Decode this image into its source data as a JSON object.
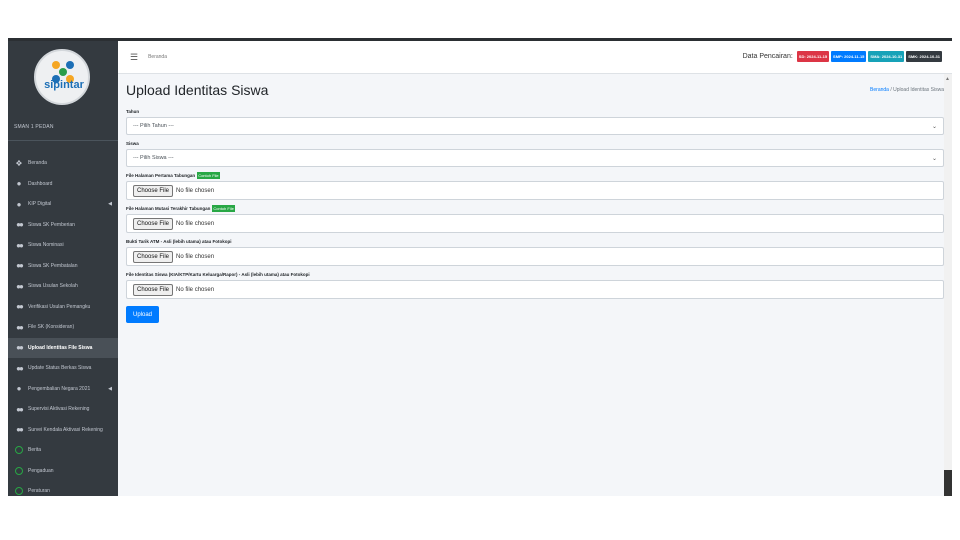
{
  "sidebar": {
    "logo_text": "sipintar",
    "school": "SMAN 1 PEDAN",
    "items": [
      {
        "label": "Beranda",
        "icon": "home-icon"
      },
      {
        "label": "Dashboard",
        "icon": "dashboard-icon"
      },
      {
        "label": "KIP Digital",
        "icon": "dashboard-icon"
      },
      {
        "label": "Siswa SK Pemberian",
        "icon": "users-icon"
      },
      {
        "label": "Siswa Nominasi",
        "icon": "users-icon"
      },
      {
        "label": "Siswa SK Pembatalan",
        "icon": "users-icon"
      },
      {
        "label": "Siswa Usulan Sekolah",
        "icon": "users-icon"
      },
      {
        "label": "Verifikasi Usulan Pemangku",
        "icon": "users-icon"
      },
      {
        "label": "File SK (Konsideran)",
        "icon": "users-icon"
      },
      {
        "label": "Upload Identitas File Siswa",
        "icon": "users-icon"
      },
      {
        "label": "Update Status Berkas Siswa",
        "icon": "users-icon"
      },
      {
        "label": "Pengembalian Negara 2021",
        "icon": "dashboard-icon"
      },
      {
        "label": "Supervisi Aktivasi Rekening",
        "icon": "users-icon"
      },
      {
        "label": "Survei Kendala Aktivasi Rekening",
        "icon": "users-icon"
      },
      {
        "label": "Berita",
        "icon": "circle-icon"
      },
      {
        "label": "Pengaduan",
        "icon": "circle-icon"
      },
      {
        "label": "Peraturan",
        "icon": "circle-icon"
      }
    ]
  },
  "topbar": {
    "breadcrumb": "Beranda",
    "pencairan_label": "Data Pencairan:",
    "badges": [
      {
        "text": "SD: 2024-11-15",
        "color": "#dc3545"
      },
      {
        "text": "SMP: 2024-11-15",
        "color": "#007bff"
      },
      {
        "text": "SMA: 2024-10-31",
        "color": "#17a2b8"
      },
      {
        "text": "SMK: 2024-10-31",
        "color": "#343a40"
      }
    ]
  },
  "main": {
    "title": "Upload Identitas Siswa",
    "breadcrumb_home": "Beranda",
    "breadcrumb_sep": "/",
    "breadcrumb_current": "Upload Identitas Siswa",
    "tahun_label": "Tahun",
    "tahun_placeholder": "--- Pilih Tahun ---",
    "siswa_label": "Siswa",
    "siswa_placeholder": "--- Pilih Siswa ---",
    "file1_label": "File Halaman Pertama Tabungan",
    "file2_label": "File Halaman Mutasi Terakhir Tabungan",
    "file3_label": "Bukti Tarik ATM - Asli (lebih utama) atau Fotokopi",
    "file4_label": "File Identitas Siswa (KIA/KTP/Kartu Keluarga/Rapor) - Asli (lebih utama) atau Fotokopi",
    "contoh_label": "Contoh File",
    "choose_label": "Choose File",
    "no_file": "No file chosen",
    "upload_label": "Upload"
  }
}
